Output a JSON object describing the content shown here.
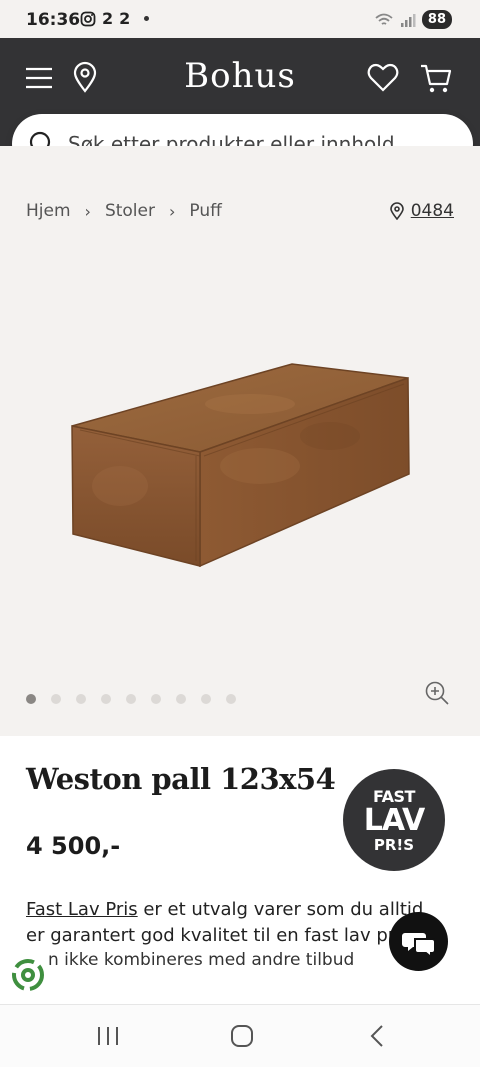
{
  "status_bar": {
    "time": "16:36",
    "left_glyphs": [
      "2",
      "2"
    ],
    "battery": "88"
  },
  "header": {
    "logo": "Bohus",
    "search_placeholder": "Søk etter produkter eller innhold..."
  },
  "breadcrumb": [
    "Hjem",
    "Stoler",
    "Puff"
  ],
  "store_code": "0484",
  "gallery": {
    "image_count": 9,
    "active_index": 0
  },
  "product": {
    "title": "Weston pall 123x54",
    "price": "4 500,-",
    "badge": {
      "line1": "FAST",
      "line2": "LAV",
      "line3": "PR!S"
    },
    "desc_link": "Fast Lav Pris",
    "desc_text": " er et utvalg varer som du alltid er garantert god kvalitet til en fast lav pris",
    "desc_note": "n ikke kombineres med andre tilbud"
  },
  "colors": {
    "header_bg": "#333335",
    "gallery_bg": "#f4f2f0",
    "product_leather": "#8f5a33"
  }
}
